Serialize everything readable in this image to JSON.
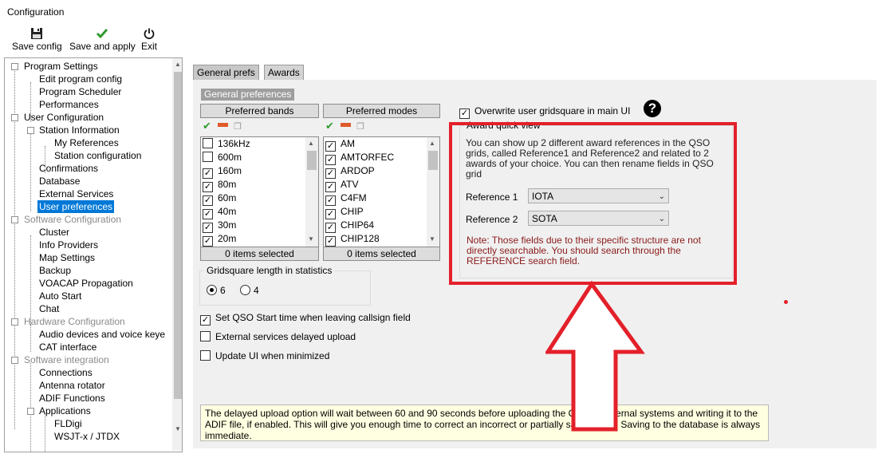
{
  "window": {
    "title": "Configuration"
  },
  "toolbar": {
    "save_config": {
      "label": "Save config",
      "icon": "floppy-icon"
    },
    "save_apply": {
      "label": "Save and apply",
      "icon": "checkmark-icon"
    },
    "exit": {
      "label": "Exit",
      "icon": "power-icon"
    }
  },
  "tree": {
    "items": [
      {
        "label": "Program Settings"
      },
      {
        "label": "Edit program config"
      },
      {
        "label": "Program Scheduler"
      },
      {
        "label": "Performances"
      },
      {
        "label": "User Configuration"
      },
      {
        "label": "Station Information"
      },
      {
        "label": "My References"
      },
      {
        "label": "Station configuration"
      },
      {
        "label": "Confirmations"
      },
      {
        "label": "Database"
      },
      {
        "label": "External Services"
      },
      {
        "label": "User preferences"
      },
      {
        "label": "Software Configuration"
      },
      {
        "label": "Cluster"
      },
      {
        "label": "Info Providers"
      },
      {
        "label": "Map Settings"
      },
      {
        "label": "Backup"
      },
      {
        "label": "VOACAP Propagation"
      },
      {
        "label": "Auto Start"
      },
      {
        "label": "Chat"
      },
      {
        "label": "Hardware Configuration"
      },
      {
        "label": "Audio devices and voice keye"
      },
      {
        "label": "CAT interface"
      },
      {
        "label": "Software integration"
      },
      {
        "label": "Connections"
      },
      {
        "label": "Antenna rotator"
      },
      {
        "label": "ADIF Functions"
      },
      {
        "label": "Applications"
      },
      {
        "label": "FLDigi"
      },
      {
        "label": "WSJT-x / JTDX"
      }
    ]
  },
  "tabs": [
    {
      "label": "General prefs"
    },
    {
      "label": "Awards"
    }
  ],
  "general": {
    "section_title": "General preferences",
    "bands": {
      "header": "Preferred bands",
      "items": [
        {
          "label": "136kHz",
          "checked": false
        },
        {
          "label": "600m",
          "checked": false
        },
        {
          "label": "160m",
          "checked": true
        },
        {
          "label": "80m",
          "checked": true
        },
        {
          "label": "60m",
          "checked": true
        },
        {
          "label": "40m",
          "checked": true
        },
        {
          "label": "30m",
          "checked": true
        },
        {
          "label": "20m",
          "checked": true
        }
      ],
      "selected_count": "0 items selected"
    },
    "modes": {
      "header": "Preferred modes",
      "items": [
        {
          "label": "AM",
          "checked": true
        },
        {
          "label": "AMTORFEC",
          "checked": true
        },
        {
          "label": "ARDOP",
          "checked": true
        },
        {
          "label": "ATV",
          "checked": true
        },
        {
          "label": "C4FM",
          "checked": true
        },
        {
          "label": "CHIP",
          "checked": true
        },
        {
          "label": "CHIP64",
          "checked": true
        },
        {
          "label": "CHIP128",
          "checked": true
        }
      ],
      "selected_count": "0 items selected"
    },
    "gridsquare": {
      "legend": "Gridsquare length in statistics",
      "options": [
        "6",
        "4"
      ],
      "selected": "6"
    },
    "checks": [
      {
        "label": "Set QSO Start time when leaving callsign field",
        "checked": true
      },
      {
        "label": "External services delayed upload",
        "checked": false
      },
      {
        "label": "Update UI when minimized",
        "checked": false
      }
    ],
    "overwrite": {
      "label": "Overwrite user gridsquare in main UI",
      "checked": true
    }
  },
  "award": {
    "legend": "Award quick view",
    "description": "You can show up 2 different award references in the QSO grids, called Reference1 and Reference2 and related to 2 awards of your choice. You can then rename fields in QSO grid",
    "ref1": {
      "label": "Reference 1",
      "value": "IOTA"
    },
    "ref2": {
      "label": "Reference 2",
      "value": "SOTA"
    },
    "note": "Note: Those fields due to their specific structure are not directly searchable. You should search through the REFERENCE search field."
  },
  "info": {
    "text": "The delayed upload option will wait between 60 and 90 seconds before uploading the QSO to external systems and writing it to the ADIF file, if enabled. This will give you enough time to correct an incorrect or partially saved QSO. Saving to the database is always immediate."
  },
  "colors": {
    "highlight": "#e3202a",
    "selection": "#0078d7",
    "note": "#8b1a1a"
  }
}
